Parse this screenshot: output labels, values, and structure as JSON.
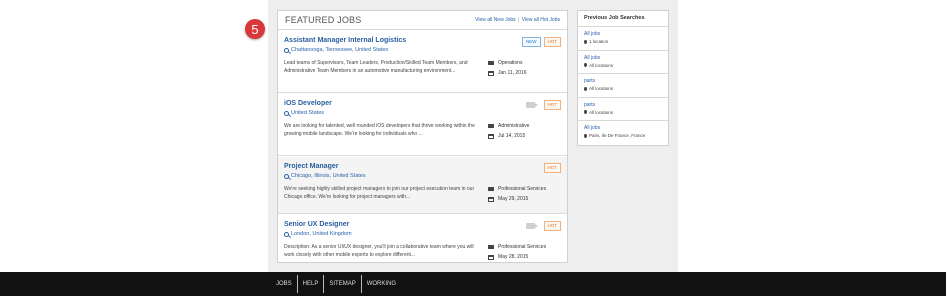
{
  "step_badge": "5",
  "featured": {
    "title": "FEATURED JOBS",
    "link_new": "View all New Jobs",
    "separator": "|",
    "link_hot": "View all Hot Jobs"
  },
  "jobs": [
    {
      "title": "Assistant Manager Internal Logistics",
      "location": "Chattanooga, Tennessee, United States",
      "description": "Lead teams of Supervisors, Team Leaders, Production/Skilled Team Members, and Administrative Team Members in an automotive manufacturing environment...",
      "category": "Operations",
      "date": "Jan 11, 2016",
      "tags": [
        "NEW",
        "HOT"
      ]
    },
    {
      "title": "iOS Developer",
      "location": "United States",
      "description": "We are looking for talented, well rounded iOS developers that thrive working within the growing mobile landscape. We're looking for individuals who ...",
      "category": "Administrative",
      "date": "Jul 14, 2015",
      "tags": [
        "HOT"
      ]
    },
    {
      "title": "Project Manager",
      "location": "Chicago, Illinois, United States",
      "description": "We're seeking highly skilled project managers to join our project execution team in our Chicago office. We're looking for project managers with...",
      "category": "Professional Services",
      "date": "May 29, 2015",
      "tags": [
        "HOT"
      ]
    },
    {
      "title": "Senior UX Designer",
      "location": "London, United Kingdom",
      "description": "Description: As a senior UI/UX designer, you'll join a collaborative team where you will work closely with other mobile experts to explore different...",
      "category": "Professional Services",
      "date": "May 28, 2015",
      "tags": [
        "HOT"
      ]
    }
  ],
  "previous_searches": {
    "title": "Previous Job Searches",
    "items": [
      {
        "query": "All jobs",
        "location": "1 location"
      },
      {
        "query": "All jobs",
        "location": "All locations"
      },
      {
        "query": "parts",
        "location": "All locations"
      },
      {
        "query": "parts",
        "location": "All locations"
      },
      {
        "query": "All jobs",
        "location": "Paris, Ile De France, France"
      }
    ]
  },
  "footer": {
    "links": [
      "JOBS",
      "HELP",
      "SITEMAP",
      "WORKING"
    ]
  },
  "colors": {
    "badge": "#d9383a",
    "link": "#2a62a8",
    "hot": "#e07b30",
    "new": "#2a7fc0",
    "footer_bg": "#111111"
  }
}
